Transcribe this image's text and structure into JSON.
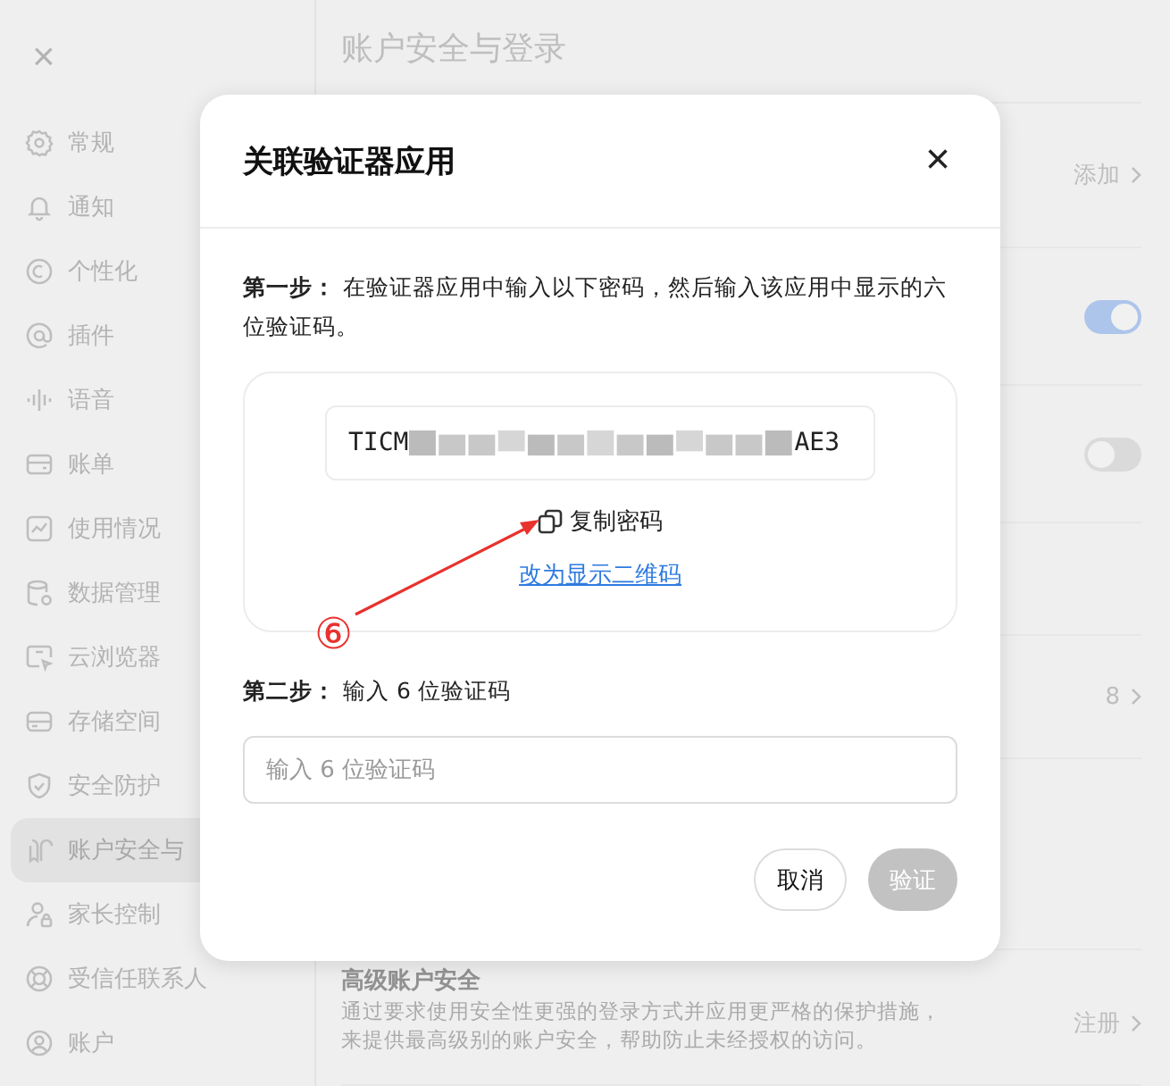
{
  "sidebar": {
    "close_label": "×",
    "items": [
      {
        "label": "常规",
        "selected": false
      },
      {
        "label": "通知",
        "selected": false
      },
      {
        "label": "个性化",
        "selected": false
      },
      {
        "label": "插件",
        "selected": false
      },
      {
        "label": "语音",
        "selected": false
      },
      {
        "label": "账单",
        "selected": false
      },
      {
        "label": "使用情况",
        "selected": false
      },
      {
        "label": "数据管理",
        "selected": false
      },
      {
        "label": "云浏览器",
        "selected": false
      },
      {
        "label": "存储空间",
        "selected": false
      },
      {
        "label": "安全防护",
        "selected": false
      },
      {
        "label": "账户安全与",
        "selected": true
      },
      {
        "label": "家长控制",
        "selected": false
      },
      {
        "label": "受信任联系人",
        "selected": false
      },
      {
        "label": "账户",
        "selected": false
      }
    ]
  },
  "page": {
    "title": "账户安全与登录",
    "rows": [
      {
        "kind": "link",
        "value": "添加"
      },
      {
        "kind": "toggle",
        "on": true
      },
      {
        "kind": "toggle",
        "on": false
      },
      {
        "kind": "blank"
      },
      {
        "kind": "link",
        "value": "8"
      },
      {
        "kind": "blank"
      },
      {
        "kind": "link",
        "title": "高级账户安全",
        "description": "通过要求使用安全性更强的登录方式并应用更严格的保护措施，来提供最高级别的账户安全，帮助防止未经授权的访问。",
        "value": "注册"
      }
    ]
  },
  "dialog": {
    "title": "关联验证器应用",
    "close": "×",
    "step1_label": "第一步：",
    "step1_text": "在验证器应用中输入以下密码，然后输入该应用中显示的六位验证码。",
    "secret_prefix": "TICM",
    "secret_suffix": "AE3",
    "copy_label": "复制密码",
    "qr_link": "改为显示二维码",
    "step2_label": "第二步：",
    "step2_text": "输入 6 位验证码",
    "code_placeholder": "输入 6 位验证码",
    "buttons": [
      {
        "label": "取消",
        "kind": "secondary",
        "disabled": false
      },
      {
        "label": "验证",
        "kind": "primary",
        "disabled": true
      }
    ]
  },
  "annotation": {
    "label": "⑥"
  }
}
